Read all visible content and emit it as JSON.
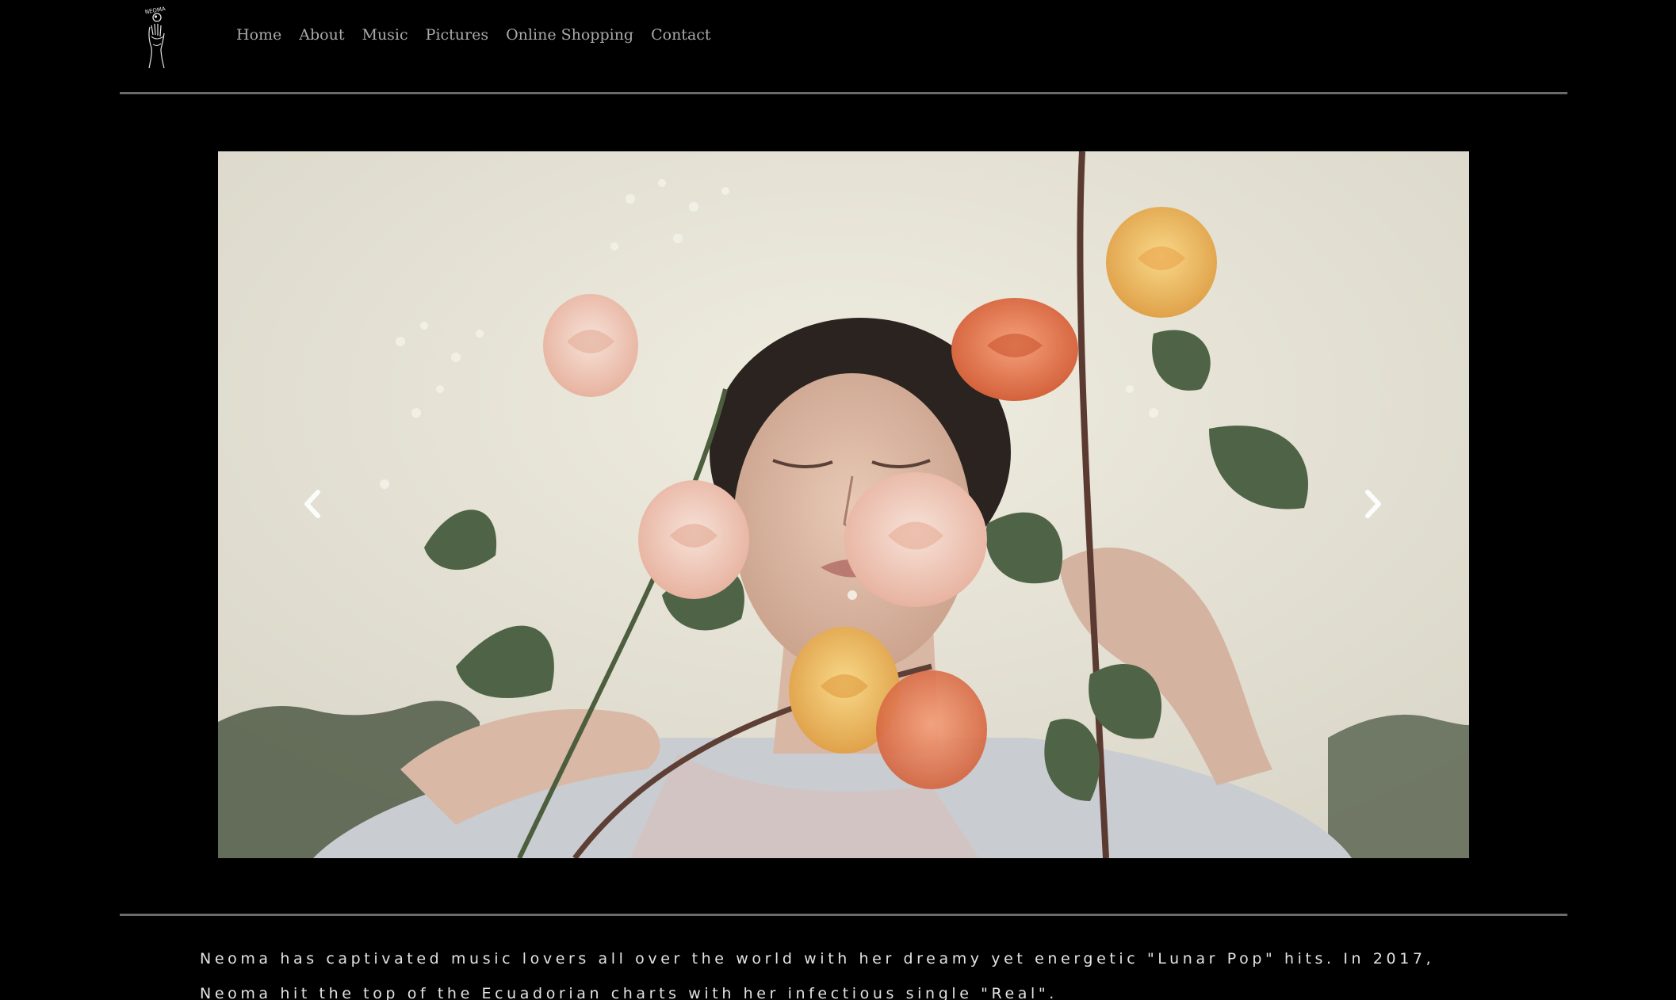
{
  "brand": {
    "logo_icon": "neoma-hand-moon-logo-icon",
    "logo_text": "NEOMA"
  },
  "nav": {
    "items": [
      {
        "label": "Home"
      },
      {
        "label": "About"
      },
      {
        "label": "Music"
      },
      {
        "label": "Pictures"
      },
      {
        "label": "Online Shopping"
      },
      {
        "label": "Contact"
      }
    ]
  },
  "carousel": {
    "slide_image": "portrait-woman-with-flowers",
    "prev_icon": "chevron-left-icon",
    "next_icon": "chevron-right-icon"
  },
  "bio": {
    "text": "Neoma has captivated music lovers all over the world with her dreamy yet energetic \"Lunar Pop\" hits. In 2017, Neoma hit the top of the Ecuadorian charts with her infectious single \"Real\"."
  },
  "colors": {
    "background": "#000000",
    "nav_text": "#a9a9a9",
    "rule": "#6b6b6b",
    "body_text": "#e2e2e2"
  }
}
